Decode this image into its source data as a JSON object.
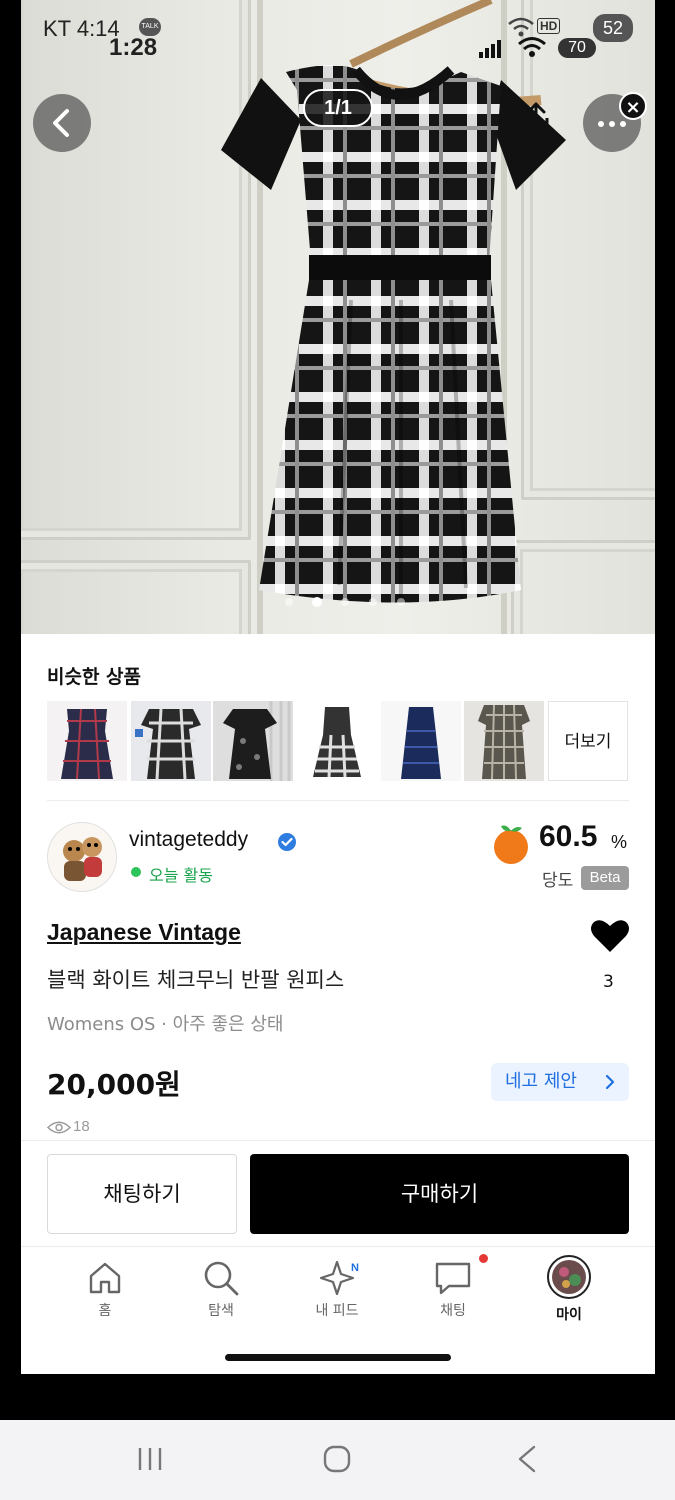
{
  "status_bar": {
    "carrier_time": "KT 4:14",
    "talk_badge": "TALK",
    "time2": "1:28",
    "battery_main": "52",
    "battery_second": "70",
    "hd_label": "HD"
  },
  "hero": {
    "counter": "1/1"
  },
  "similar": {
    "title": "비슷한 상품",
    "more_label": "더보기",
    "thumbs": [
      "navy-plaid-dress",
      "black-white-check-dress",
      "dark-floral-dress",
      "black-white-check-sleeveless",
      "navy-sleeveless-dress",
      "tweed-dress"
    ]
  },
  "seller": {
    "name": "vintageteddy",
    "status": "오늘 활동",
    "score": "60.5",
    "score_unit": "%",
    "score_label": "당도",
    "beta": "Beta"
  },
  "product": {
    "brand": "Japanese Vintage",
    "title": "블랙 화이트 체크무늬 반팔 원피스",
    "meta": "Womens OS · 아주 좋은 상태",
    "price": "20,000원",
    "offer_label": "네고 제안",
    "views": "18",
    "likes": "3"
  },
  "actions": {
    "chat_label": "채팅하기",
    "buy_label": "구매하기"
  },
  "tabs": {
    "home": "홈",
    "search": "탐색",
    "feed": "내 피드",
    "feed_badge": "N",
    "chat": "채팅",
    "my": "마이"
  },
  "colors": {
    "accent_blue": "#1f6fe0",
    "online_green": "#2ec45a",
    "notify_red": "#e53935",
    "primary_black": "#000000"
  }
}
